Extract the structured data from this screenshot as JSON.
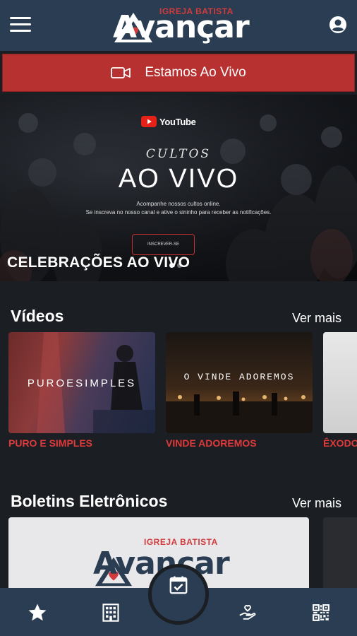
{
  "header": {
    "logo_top": "IGREJA BATISTA",
    "logo_main": "Avançar",
    "menu_icon": "hamburger-menu-icon",
    "user_icon": "account-circle-icon"
  },
  "live_banner": {
    "label": "Estamos Ao Vivo",
    "icon": "video-camera-icon"
  },
  "hero": {
    "youtube_label": "YouTube",
    "cultos": "CULTOS",
    "ao_vivo": "AO VIVO",
    "subtitle_line1": "Acompanhe nossos cultos online.",
    "subtitle_line2": "Se inscreva no nosso canal e ative o sininho para receber as notificações.",
    "subscribe": "INSCREVER-SE",
    "title": "CELEBRAÇÕES AO VIVO",
    "dots_total": 3,
    "active_dot": 0
  },
  "videos": {
    "title": "Vídeos",
    "see_more": "Ver mais",
    "items": [
      {
        "label": "PURO E SIMPLES",
        "art_text": "PUROESIMPLES"
      },
      {
        "label": "VINDE ADOREMOS",
        "art_text": "O VINDE ADOREMOS"
      },
      {
        "label": "ÊXODO",
        "art_text": ""
      }
    ]
  },
  "bulletins": {
    "title": "Boletins Eletrônicos",
    "see_more": "Ver mais",
    "logo_top": "IGREJA BATISTA",
    "logo_main": "Avançar"
  },
  "bottom_nav": {
    "items": [
      {
        "icon": "star-icon"
      },
      {
        "icon": "building-icon"
      },
      {
        "icon": "calendar-check-icon"
      },
      {
        "icon": "hand-heart-icon"
      },
      {
        "icon": "qr-code-icon"
      }
    ]
  },
  "colors": {
    "header_bg": "#2a3d52",
    "accent_red": "#b73131",
    "label_red": "#e03a3a",
    "page_bg": "#1b1f24"
  }
}
